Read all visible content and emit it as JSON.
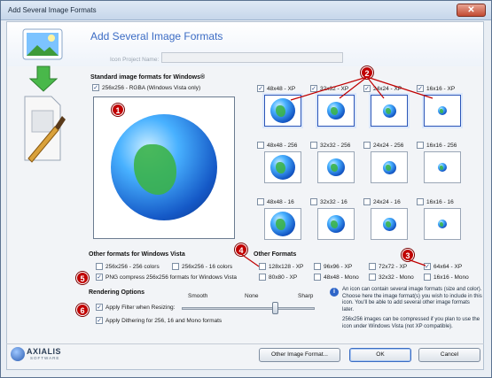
{
  "window": {
    "title": "Add Several Image Formats",
    "close_label": "✕"
  },
  "header": {
    "title": "Add Several Image Formats",
    "project_label": "Icon Project Name:",
    "project_value": ""
  },
  "standard": {
    "heading": "Standard image formats for Windows®",
    "main_format": {
      "label": "256x256 - RGBA (Windows Vista only)",
      "checked": true
    },
    "rows": [
      [
        {
          "label": "48x48 - XP",
          "checked": true
        },
        {
          "label": "32x32 - XP",
          "checked": true
        },
        {
          "label": "24x24 - XP",
          "checked": true
        },
        {
          "label": "16x16 - XP",
          "checked": true
        }
      ],
      [
        {
          "label": "48x48 - 256",
          "checked": false
        },
        {
          "label": "32x32 - 256",
          "checked": false
        },
        {
          "label": "24x24 - 256",
          "checked": false
        },
        {
          "label": "16x16 - 256",
          "checked": false
        }
      ],
      [
        {
          "label": "48x48 - 16",
          "checked": false
        },
        {
          "label": "32x32 - 16",
          "checked": false
        },
        {
          "label": "24x24 - 16",
          "checked": false
        },
        {
          "label": "16x16 - 16",
          "checked": false
        }
      ]
    ]
  },
  "vista": {
    "heading": "Other formats for Windows Vista",
    "items": [
      {
        "label": "256x256 - 256 colors",
        "checked": false
      },
      {
        "label": "256x256 - 16 colors",
        "checked": false
      },
      {
        "label": "PNG compress 256x256 formats for Windows Vista",
        "checked": true
      }
    ]
  },
  "other": {
    "heading": "Other Formats",
    "items": [
      {
        "label": "128x128 - XP",
        "checked": false
      },
      {
        "label": "96x96 - XP",
        "checked": false
      },
      {
        "label": "72x72 - XP",
        "checked": false
      },
      {
        "label": "64x64 - XP",
        "checked": true
      },
      {
        "label": "80x80 - XP",
        "checked": false
      },
      {
        "label": "48x48 - Mono",
        "checked": false
      },
      {
        "label": "32x32 - Mono",
        "checked": false
      },
      {
        "label": "16x16 - Mono",
        "checked": false
      }
    ]
  },
  "rendering": {
    "heading": "Rendering Options",
    "filter": {
      "label": "Apply Filter when Resizing:",
      "checked": true
    },
    "dither": {
      "label": "Apply Dithering for 256, 16 and Mono formats",
      "checked": true
    },
    "slider_labels": {
      "left": "Smooth",
      "mid": "None",
      "right": "Sharp"
    },
    "slider_value": 0.7
  },
  "info": {
    "icon": "i",
    "text1": "An icon can contain several image formats (size and color). Choose here the image format(s) you wish to include in this icon. You'll be able to add several other image formats later.",
    "text2": "256x256 images can be compressed if you plan to use the icon under Windows Vista (not XP compatible)."
  },
  "buttons": {
    "other": "Other Image Format...",
    "ok": "OK",
    "cancel": "Cancel"
  },
  "logo": {
    "word": "AXIALIS",
    "sub": "SOFTWARE"
  },
  "badges": [
    "1",
    "2",
    "3",
    "4",
    "5",
    "6"
  ],
  "colors": {
    "accent": "#3b6bc4",
    "badge": "#c00000",
    "title": "#1c2b3d"
  }
}
